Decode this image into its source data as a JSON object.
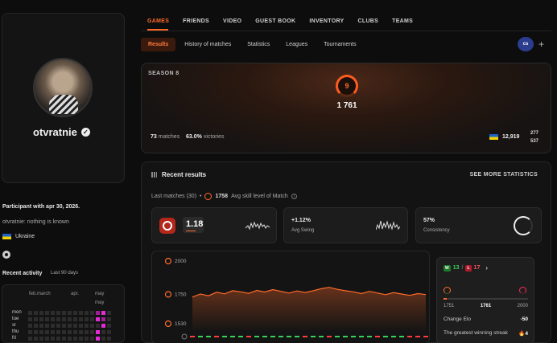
{
  "profile": {
    "nickname": "otvratnie",
    "participant_since": "Participant with apr 30, 2026.",
    "bio": "otvratnie: nothing is known",
    "country": "Ukraine"
  },
  "activity": {
    "title": "Recent activity",
    "subtitle": "Last 90 days",
    "months": [
      "feb.march",
      "apr.",
      "may",
      "may"
    ],
    "days": [
      "mon",
      "tue",
      "sr",
      "thu",
      "fri"
    ]
  },
  "nav": {
    "tabs": [
      "GAMES",
      "FRIENDS",
      "VIDEO",
      "GUEST BOOK",
      "INVENTORY",
      "CLUBS",
      "TEAMS"
    ],
    "subtabs": [
      "Results",
      "History of matches",
      "Statistics",
      "Leagues",
      "Tournaments"
    ],
    "game_logo": "cs",
    "add_label": "+"
  },
  "season": {
    "label": "SEASON 8",
    "level": "9",
    "elo": "1 761",
    "matches_value": "73",
    "matches_label": "matches",
    "victories_value": "63.0%",
    "victories_label": "victories",
    "rank_value": "12,919",
    "rank_top": "277",
    "rank_bottom": "537"
  },
  "recent": {
    "title": "Recent results",
    "see_more": "SEE MORE STATISTICS",
    "last_matches_label": "Last matches (30)",
    "avg_elo": "1758",
    "avg_label": "Avg skill level of Match",
    "kd_value": "1.18",
    "swing_value": "+1.12%",
    "swing_label": "Avg Swing",
    "consistency_value": "57%",
    "consistency_label": "Consistency"
  },
  "elo_chart": {
    "y_ticks": [
      "2000",
      "1750",
      "1530"
    ]
  },
  "chart_data": {
    "type": "line",
    "x": [
      1,
      2,
      3,
      4,
      5,
      6,
      7,
      8,
      9,
      10,
      11,
      12,
      13,
      14,
      15,
      16,
      17,
      18,
      19,
      20,
      21,
      22,
      23,
      24,
      25,
      26,
      27,
      28,
      29,
      30
    ],
    "series": [
      {
        "values": [
          1742,
          1765,
          1752,
          1778,
          1766,
          1790,
          1781,
          1770,
          1792,
          1780,
          1798,
          1785,
          1772,
          1788,
          1776,
          1790,
          1805,
          1815,
          1800,
          1790,
          1781,
          1768,
          1785,
          1772,
          1760,
          1775,
          1765,
          1755,
          1768,
          1761
        ]
      }
    ],
    "ylim": [
      1530,
      2000
    ],
    "results": [
      "L",
      "W",
      "W",
      "L",
      "W",
      "W",
      "W",
      "L",
      "W",
      "W",
      "W",
      "W",
      "W",
      "W",
      "L",
      "W",
      "W",
      "L",
      "W",
      "W",
      "W",
      "W",
      "W",
      "L",
      "W",
      "W",
      "W",
      "L",
      "L",
      "L"
    ],
    "grid": false
  },
  "elo_panel": {
    "wins": "13",
    "losses": "17",
    "min": "1751",
    "current": "1761",
    "max": "2000",
    "progress": 0.04,
    "change_label": "Change Elo",
    "change_value": "-50",
    "streak_label": "The greatest winning streak",
    "streak_value": "4"
  },
  "colors": {
    "accent": "#ff6a2a",
    "win": "#39d158",
    "loss": "#ff3b3b",
    "activity": "#e22bd6"
  }
}
